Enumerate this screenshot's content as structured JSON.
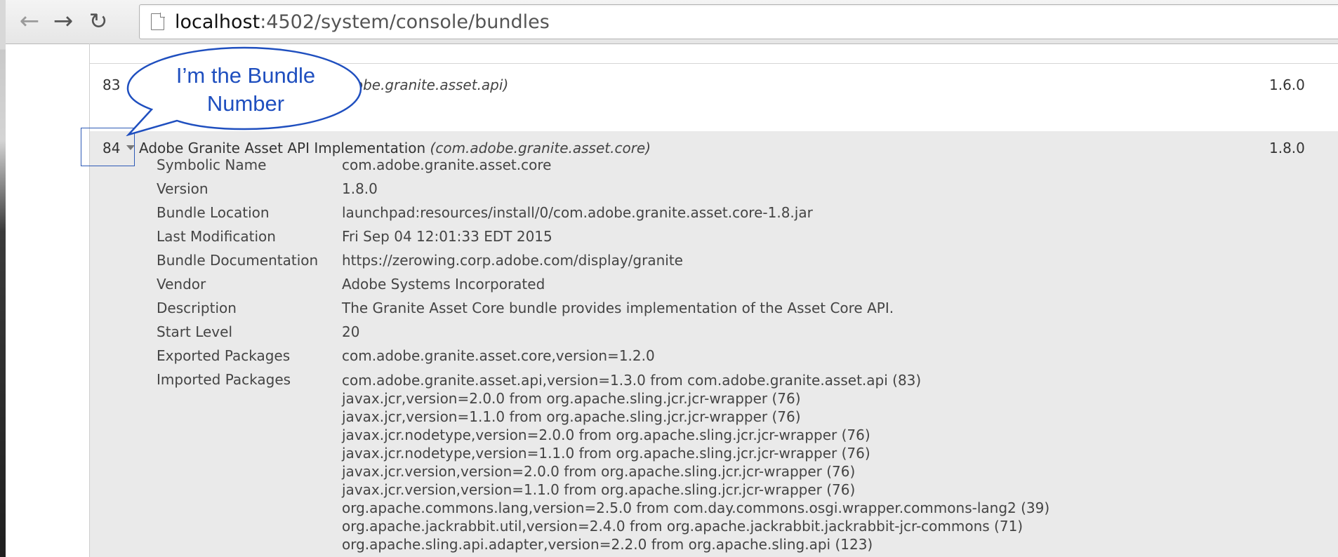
{
  "browser": {
    "url_host": "localhost",
    "url_rest": ":4502/system/console/bundles",
    "back_icon": "back-arrow-icon",
    "forward_icon": "forward-arrow-icon",
    "reload_icon": "reload-icon"
  },
  "annotation": {
    "line1": "I’m the Bundle",
    "line2": "Number",
    "color": "#1f4fbf"
  },
  "bundles": [
    {
      "id": "83",
      "name": "",
      "symbolic": "(com.adobe.granite.asset.api)",
      "version": "1.6.0"
    },
    {
      "id": "84",
      "name": "Adobe Granite Asset API Implementation",
      "symbolic": "(com.adobe.granite.asset.core)",
      "version": "1.8.0",
      "details": [
        {
          "label": "Symbolic Name",
          "value": "com.adobe.granite.asset.core"
        },
        {
          "label": "Version",
          "value": "1.8.0"
        },
        {
          "label": "Bundle Location",
          "value": "launchpad:resources/install/0/com.adobe.granite.asset.core-1.8.jar"
        },
        {
          "label": "Last Modification",
          "value": "Fri Sep 04 12:01:33 EDT 2015"
        },
        {
          "label": "Bundle Documentation",
          "value": "https://zerowing.corp.adobe.com/display/granite"
        },
        {
          "label": "Vendor",
          "value": "Adobe Systems Incorporated"
        },
        {
          "label": "Description",
          "value": "The Granite Asset Core bundle provides implementation of the Asset Core API."
        },
        {
          "label": "Start Level",
          "value": "20"
        },
        {
          "label": "Exported Packages",
          "value": "com.adobe.granite.asset.core,version=1.2.0"
        }
      ],
      "imported_label": "Imported Packages",
      "imported": [
        "com.adobe.granite.asset.api,version=1.3.0 from com.adobe.granite.asset.api (83)",
        "javax.jcr,version=2.0.0 from org.apache.sling.jcr.jcr-wrapper (76)",
        "javax.jcr,version=1.1.0 from org.apache.sling.jcr.jcr-wrapper (76)",
        "javax.jcr.nodetype,version=2.0.0 from org.apache.sling.jcr.jcr-wrapper (76)",
        "javax.jcr.nodetype,version=1.1.0 from org.apache.sling.jcr.jcr-wrapper (76)",
        "javax.jcr.version,version=2.0.0 from org.apache.sling.jcr.jcr-wrapper (76)",
        "javax.jcr.version,version=1.1.0 from org.apache.sling.jcr.jcr-wrapper (76)",
        "org.apache.commons.lang,version=2.5.0 from com.day.commons.osgi.wrapper.commons-lang2 (39)",
        "org.apache.jackrabbit.util,version=2.4.0 from org.apache.jackrabbit.jackrabbit-jcr-commons (71)",
        "org.apache.sling.api.adapter,version=2.2.0 from org.apache.sling.api (123)"
      ]
    }
  ]
}
